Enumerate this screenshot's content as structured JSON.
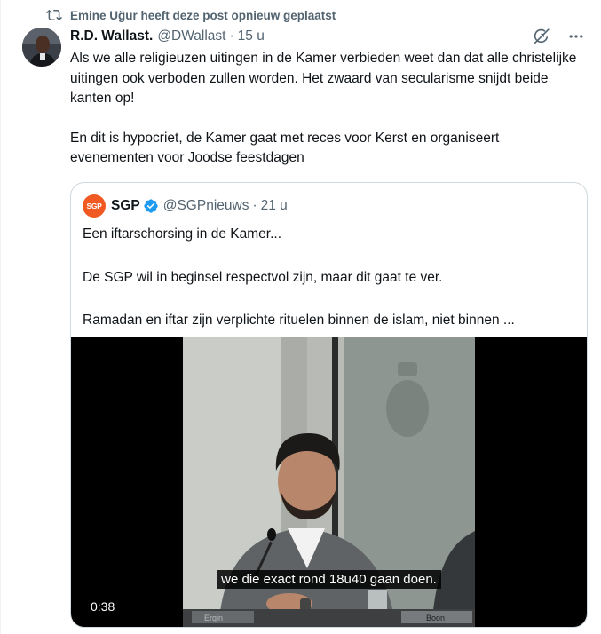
{
  "repost": {
    "text": "Emine Uğur heeft deze post opnieuw geplaatst",
    "icon": "repost-icon"
  },
  "post": {
    "author_name": "R.D. Wallast.",
    "handle": "@DWallast",
    "separator": "·",
    "time": "15 u",
    "paragraphs": [
      "Als we alle religieuzen uitingen in de Kamer verbieden weet dan dat alle christelijke uitingen ook verboden zullen worden. Het zwaard van secularisme snijdt beide kanten op!",
      "En dit is hypocriet, de Kamer gaat met reces voor Kerst en organiseert evenementen voor Joodse feestdagen"
    ]
  },
  "quote": {
    "logo_text": "SGP",
    "name": "SGP",
    "handle": "@SGPnieuws",
    "separator": "·",
    "time": "21 u",
    "paragraphs": [
      "Een iftarschorsing in de Kamer...",
      "De SGP wil in beginsel respectvol zijn, maar dit gaat te ver.",
      "Ramadan en iftar zijn verplichte rituelen binnen de islam, niet binnen ..."
    ]
  },
  "video": {
    "subtitle": "we die exact rond 18u40 gaan doen.",
    "duration": "0:38",
    "nameplate_left": "Ergin",
    "nameplate_right": "Boon"
  },
  "colors": {
    "text": "#0f1419",
    "secondary": "#536471",
    "border": "#cfd9de",
    "verified": "#1d9bf0",
    "sgp_orange": "#f05a22"
  }
}
